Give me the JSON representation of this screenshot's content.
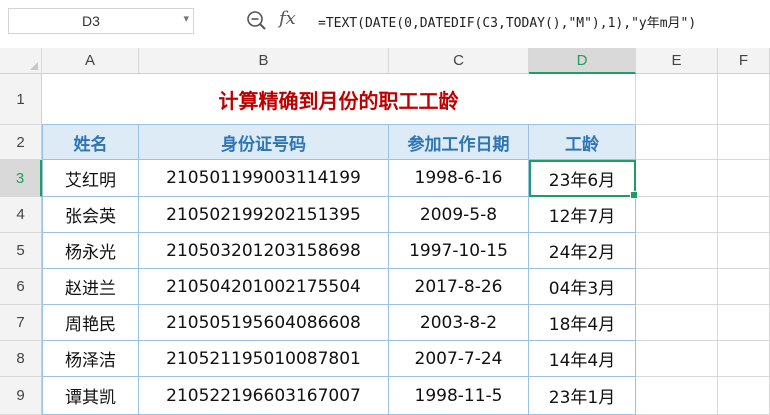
{
  "name_box": {
    "value": "D3"
  },
  "formula_bar": {
    "zoom_icon": "zoom-icon",
    "fx_label": "fx",
    "formula": "=TEXT(DATE(0,DATEDIF(C3,TODAY(),\"M\"),1),\"y年m月\")"
  },
  "columns": [
    "A",
    "B",
    "C",
    "D",
    "E",
    "F"
  ],
  "rows": [
    "1",
    "2",
    "3",
    "4",
    "5",
    "6",
    "7",
    "8",
    "9"
  ],
  "sheet": {
    "title": "计算精确到月份的职工工龄",
    "headers": [
      "姓名",
      "身份证号码",
      "参加工作日期",
      "工龄"
    ],
    "data": [
      [
        "艾红明",
        "210501199003114199",
        "1998-6-16",
        "23年6月"
      ],
      [
        "张会英",
        "210502199202151395",
        "2009-5-8",
        "12年7月"
      ],
      [
        "杨永光",
        "210503201203158698",
        "1997-10-15",
        "24年2月"
      ],
      [
        "赵进兰",
        "210504201002175504",
        "2017-8-26",
        "04年3月"
      ],
      [
        "周艳民",
        "210505195604086608",
        "2003-8-2",
        "18年4月"
      ],
      [
        "杨泽洁",
        "210521195010087801",
        "2007-7-24",
        "14年4月"
      ],
      [
        "谭其凯",
        "210522196603167007",
        "1998-11-5",
        "23年1月"
      ]
    ]
  },
  "selection": {
    "cell": "D3",
    "color": "#1e9e62"
  },
  "colors": {
    "title": "#c00000",
    "header_text": "#2e75b6",
    "header_fill": "#ddebf7"
  }
}
